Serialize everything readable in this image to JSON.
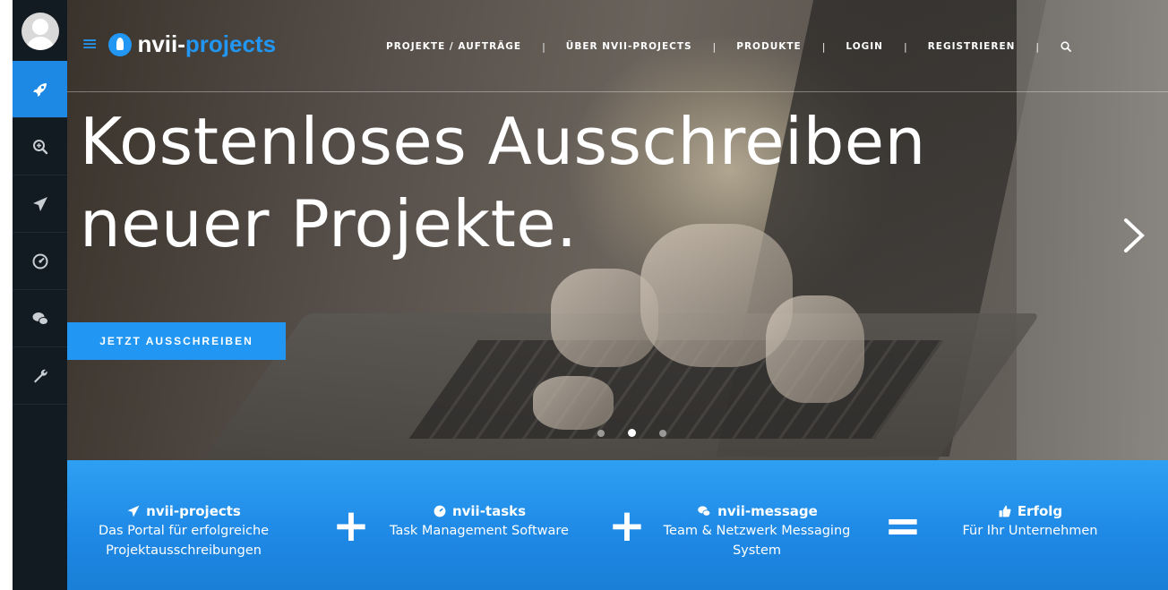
{
  "sidebar": {
    "items": [
      {
        "icon": "rocket-icon",
        "active": true
      },
      {
        "icon": "zoom-in-icon",
        "active": false
      },
      {
        "icon": "paper-plane-icon",
        "active": false
      },
      {
        "icon": "dashboard-icon",
        "active": false
      },
      {
        "icon": "chat-bubbles-icon",
        "active": false
      },
      {
        "icon": "wrench-icon",
        "active": false
      }
    ]
  },
  "header": {
    "logo_part1": "nvii-",
    "logo_part2": "projects",
    "nav": [
      "PROJEKTE / AUFTRÄGE",
      "ÜBER NVII-PROJECTS",
      "PRODUKTE",
      "LOGIN",
      "REGISTRIEREN"
    ],
    "separator": "|"
  },
  "hero": {
    "headline_line1": "Kostenloses Ausschreiben",
    "headline_line2": "neuer Projekte.",
    "cta_label": "JETZT AUSSCHREIBEN",
    "slides_total": 3,
    "slide_active": 2
  },
  "band": {
    "features": [
      {
        "icon": "paper-plane-icon",
        "title": "nvii-projects",
        "desc_line1": "Das Portal für erfolgreiche",
        "desc_line2": "Projektausschreibungen"
      },
      {
        "icon": "dashboard-icon",
        "title": "nvii-tasks",
        "desc_line1": "Task Management Software",
        "desc_line2": ""
      },
      {
        "icon": "chat-bubbles-icon",
        "title": "nvii-message",
        "desc_line1": "Team & Netzwerk Messaging",
        "desc_line2": "System"
      },
      {
        "icon": "thumbs-up-icon",
        "title": "Erfolg",
        "desc_line1": "Für Ihr Unternehmen",
        "desc_line2": ""
      }
    ],
    "operators": [
      "+",
      "+",
      "="
    ]
  },
  "colors": {
    "accent": "#2196f3",
    "sidebar_bg": "#121a22"
  }
}
